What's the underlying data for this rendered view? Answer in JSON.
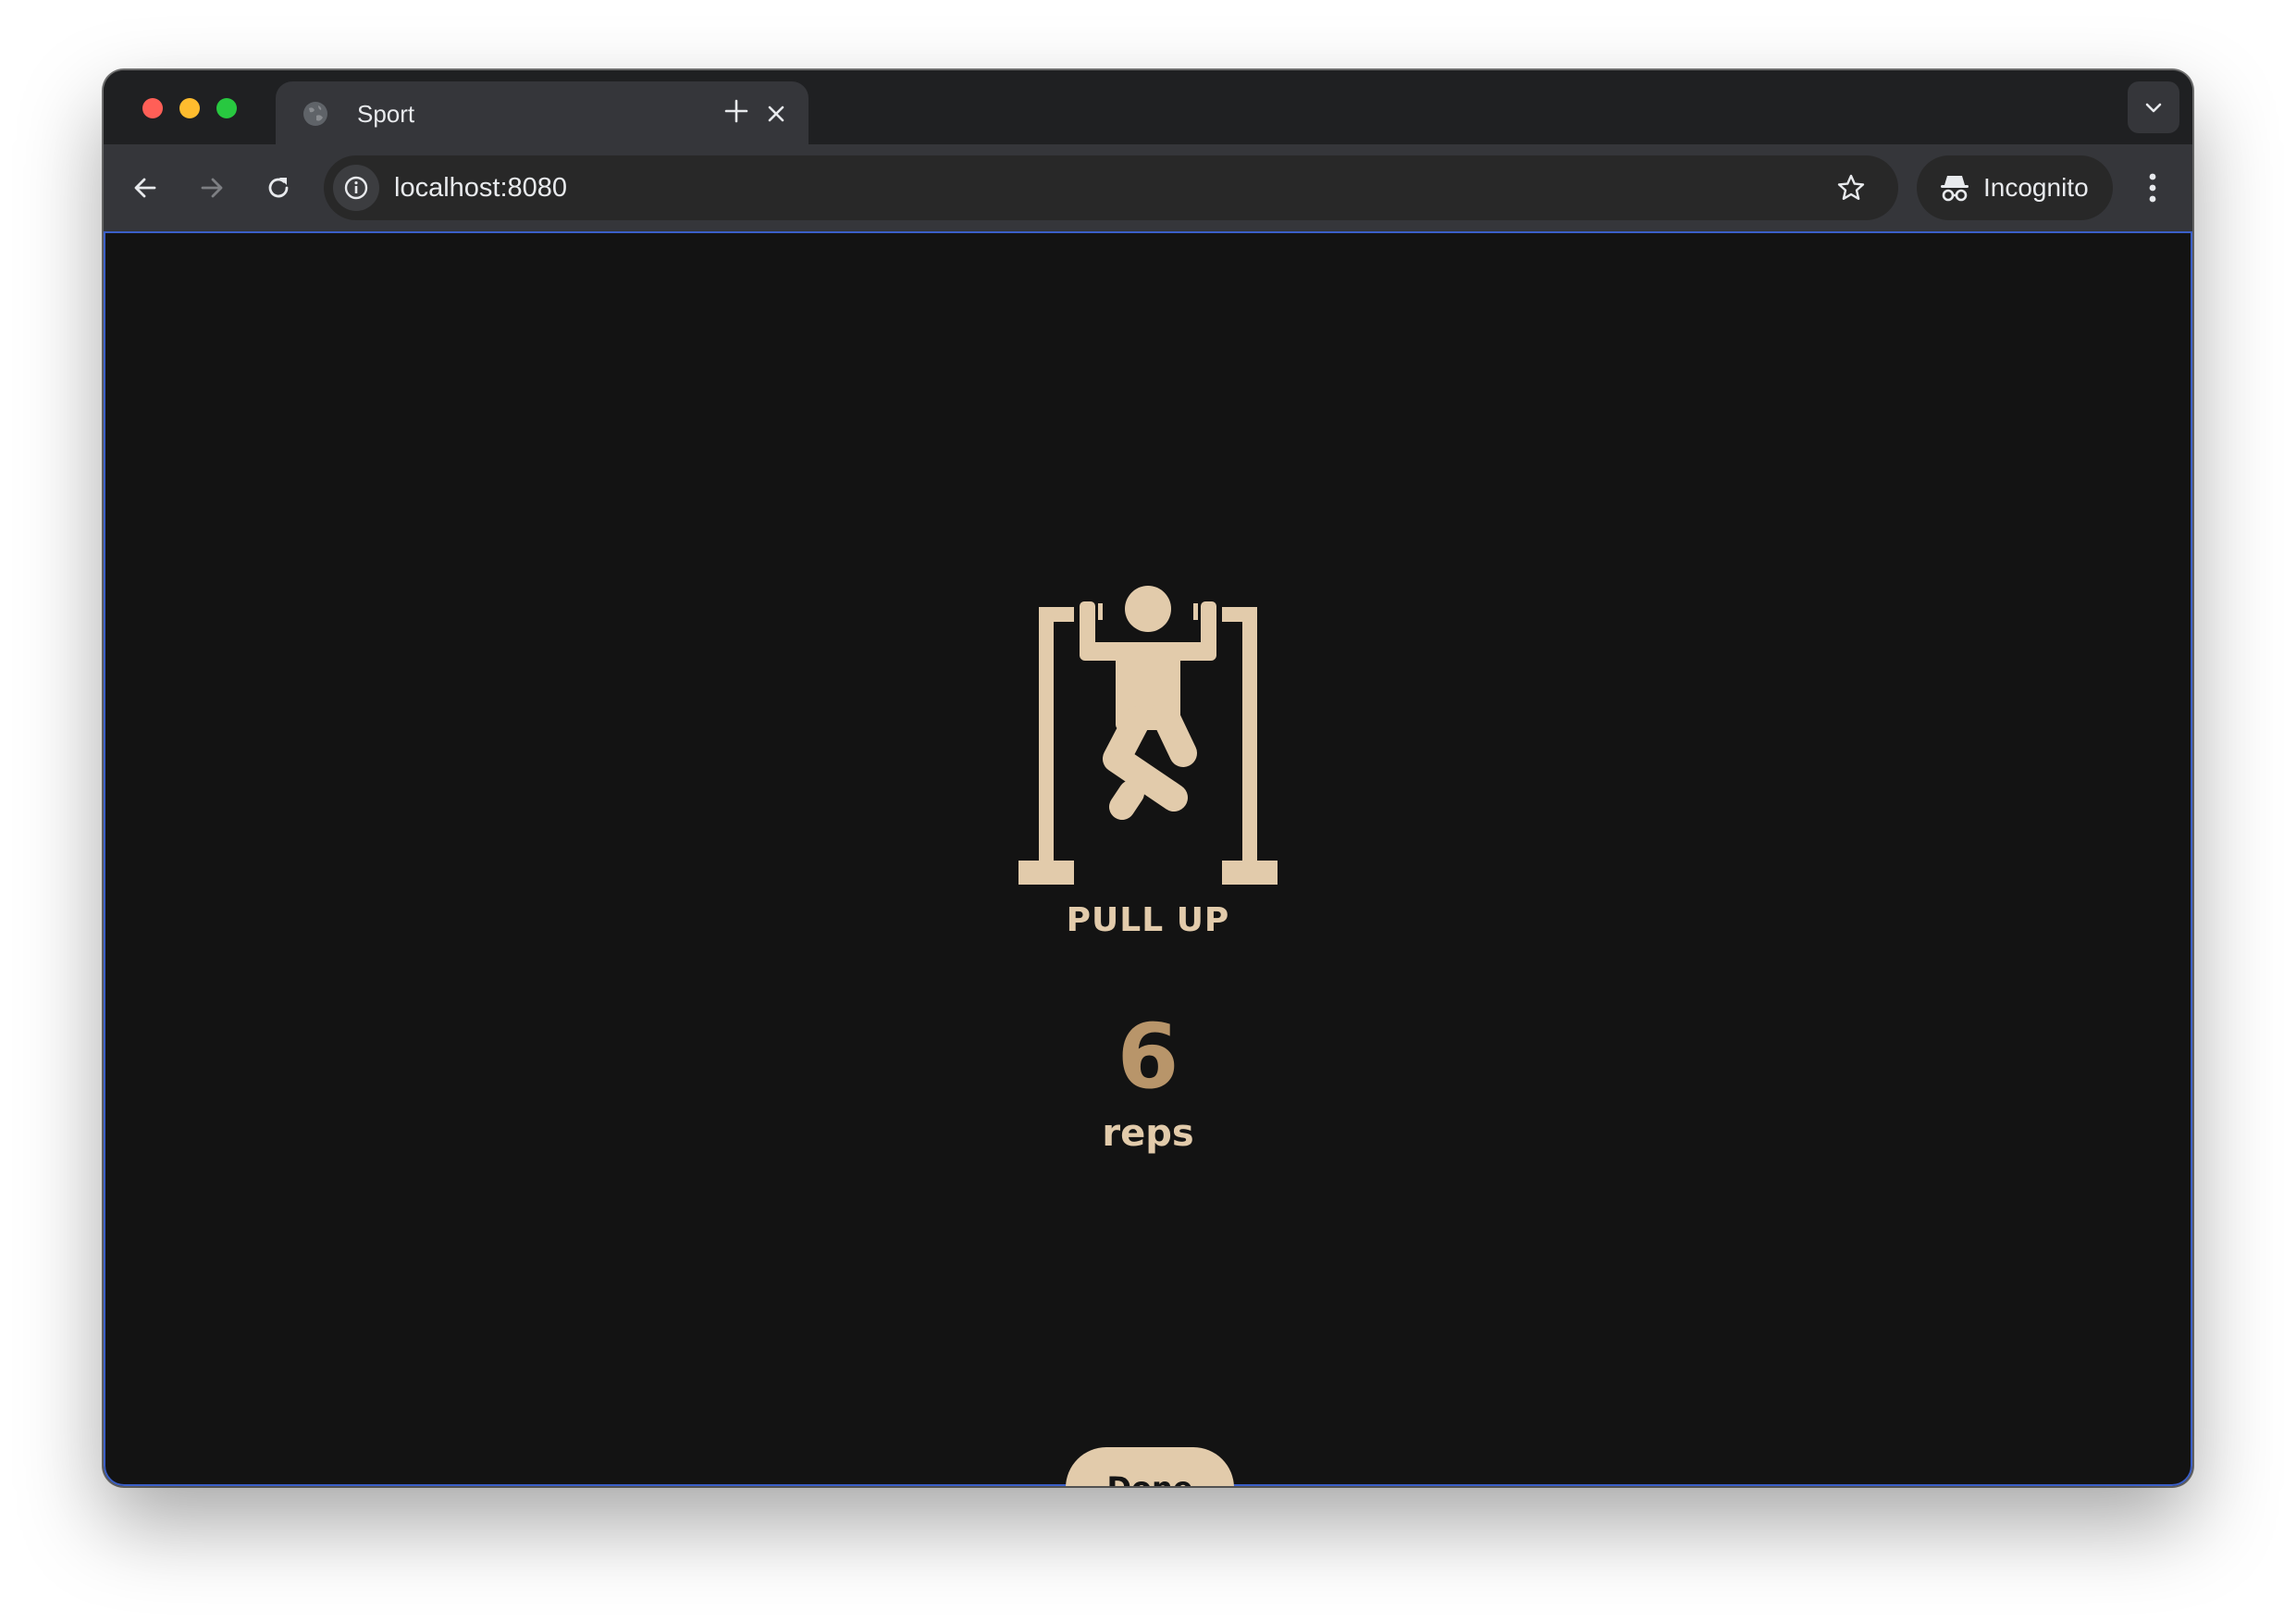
{
  "browser": {
    "tab": {
      "title": "Sport",
      "favicon": "globe-icon"
    },
    "address_bar": {
      "url": "localhost:8080"
    },
    "profile": {
      "label": "Incognito",
      "icon": "incognito-icon"
    }
  },
  "page": {
    "exercise": {
      "name": "PULL UP",
      "icon": "pull-up-icon"
    },
    "reps": {
      "count": "6",
      "unit": "reps"
    },
    "done_label": "Done"
  },
  "colors": {
    "page_background": "#131313",
    "accent_beige": "#e2cbab",
    "count_tan": "#b8956a",
    "button_text": "#141414"
  }
}
